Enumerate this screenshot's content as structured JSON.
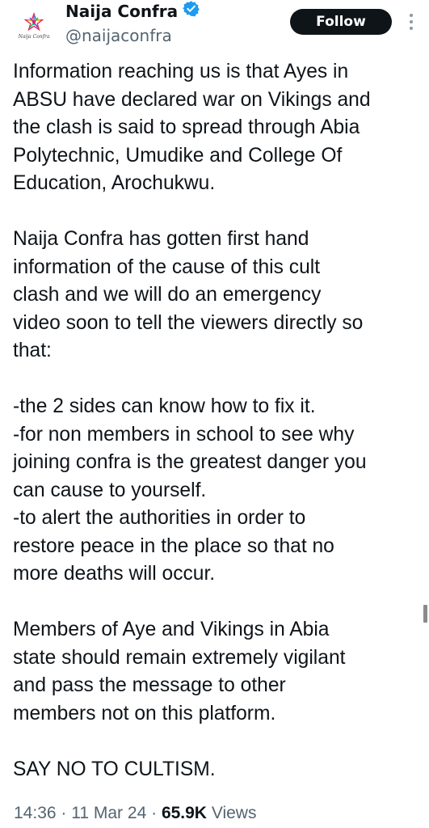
{
  "account": {
    "display_name": "Naija Confra",
    "handle": "@naijaconfra",
    "avatar_signature": "Naija Confra",
    "verified": true
  },
  "follow_label": "Follow",
  "tweet": {
    "paragraphs": [
      [
        "Information reaching us is that Ayes in",
        "ABSU have declared war on Vikings and",
        "the clash is said to spread through Abia",
        "Polytechnic, Umudike and College Of",
        "Education, Arochukwu."
      ],
      [
        "Naija Confra has gotten first hand",
        "information of the cause of this cult",
        "clash and we will do an emergency",
        "video soon to tell the viewers directly so",
        "that:"
      ],
      [
        "-the 2 sides can know how to fix it.",
        "-for non members in school to see why",
        "joining confra is the greatest danger you",
        "can cause to yourself.",
        "-to alert the authorities in order to",
        "restore peace in the place so that no",
        "more deaths will occur."
      ],
      [
        "Members of Aye and Vikings in Abia",
        "state should remain extremely vigilant",
        "and pass the message to other",
        "members not on this platform."
      ],
      [
        "SAY NO TO CULTISM."
      ]
    ]
  },
  "meta": {
    "time": "14:36",
    "separator": "·",
    "date": "11 Mar 24",
    "views_count": "65.9K",
    "views_label": "Views"
  },
  "colors": {
    "text": "#0f1419",
    "secondary": "#536471",
    "verified_blue": "#1d9bf0",
    "follow_bg": "#0f1419"
  }
}
